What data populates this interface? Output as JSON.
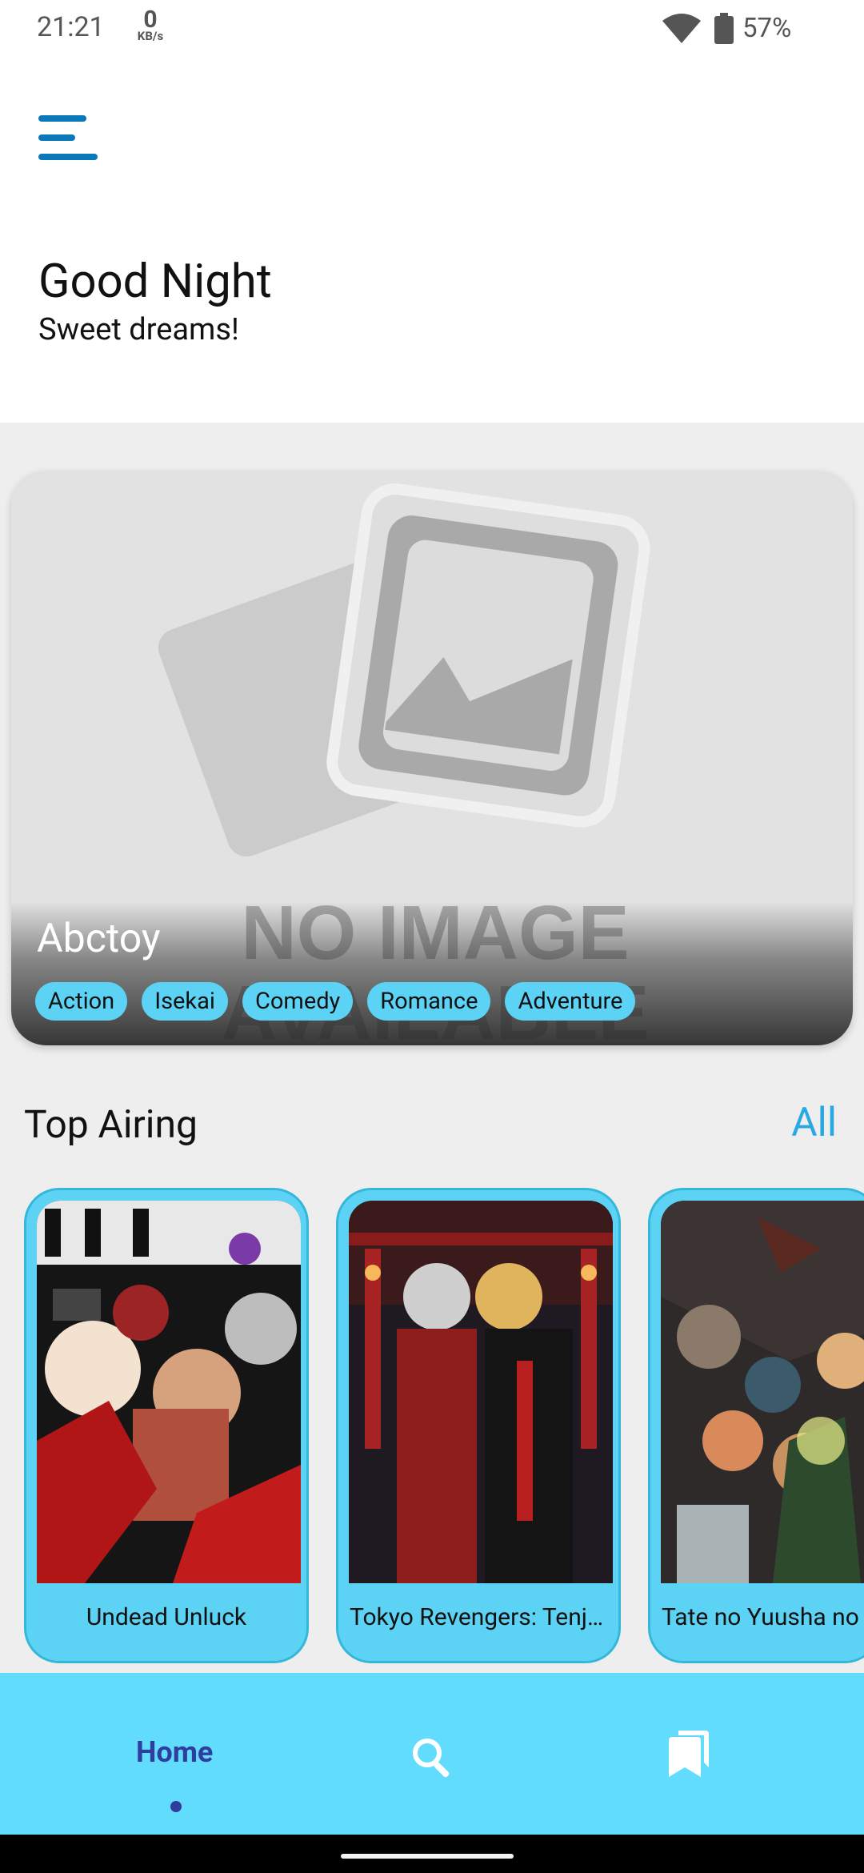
{
  "status_bar": {
    "time": "21:21",
    "net_speed_value": "0",
    "net_speed_unit": "KB/s",
    "battery_percent": "57%",
    "wifi_icon": "wifi-icon",
    "battery_icon": "battery-icon"
  },
  "header": {
    "menu_icon": "menu-icon",
    "greeting": "Good Night",
    "subtitle": "Sweet dreams!"
  },
  "featured": {
    "placeholder_text_1": "NO IMAGE",
    "placeholder_text_2": "AVAILABLE",
    "title": "Abctoy",
    "genres": [
      "Action",
      "Isekai",
      "Comedy",
      "Romance",
      "Adventure"
    ]
  },
  "top_airing": {
    "title": "Top Airing",
    "all_label": "All",
    "items": [
      {
        "name": "Undead Unluck"
      },
      {
        "name": "Tokyo Revengers: Tenjiku-hen"
      },
      {
        "name": "Tate no Yuusha no Nariagari"
      }
    ]
  },
  "bottom_nav": {
    "home_label": "Home",
    "search_icon": "search-icon",
    "library_icon": "library-icon"
  },
  "colors": {
    "accent": "#5cd3f5",
    "nav_background": "#62dcfc",
    "active_nav": "#2f3d9e",
    "link": "#29a9e3",
    "menu_icon": "#0a79b9"
  }
}
